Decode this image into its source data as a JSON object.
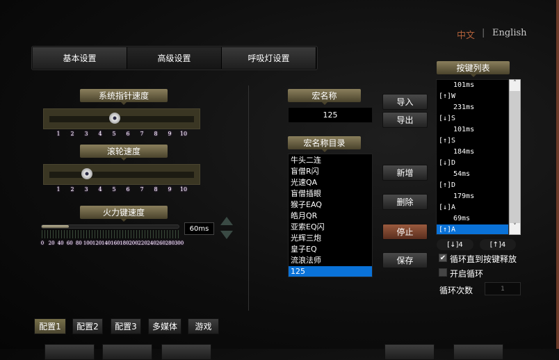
{
  "language": {
    "chinese": "中文",
    "separator": "|",
    "english": "English",
    "active_color": "#b0603a"
  },
  "tabs": [
    {
      "label": "基本设置"
    },
    {
      "label": "高级设置",
      "selected": true
    },
    {
      "label": "呼吸灯设置"
    }
  ],
  "pointer_speed": {
    "label": "系统指针速度",
    "value": 5,
    "ticks": [
      "1",
      "2",
      "3",
      "4",
      "5",
      "6",
      "7",
      "8",
      "9",
      "10"
    ]
  },
  "wheel_speed": {
    "label": "滚轮速度",
    "value": 3,
    "ticks": [
      "1",
      "2",
      "3",
      "4",
      "5",
      "6",
      "7",
      "8",
      "9",
      "10"
    ]
  },
  "fire_speed": {
    "label": "火力键速度",
    "value": 60,
    "max": 300,
    "display": "60ms",
    "ticks": [
      "0",
      "20",
      "40",
      "60",
      "80",
      "100",
      "120",
      "140",
      "160",
      "180",
      "200",
      "220",
      "240",
      "260",
      "280",
      "300"
    ]
  },
  "macro": {
    "name_label": "宏名称",
    "name_value": "125",
    "dir_label": "宏名称目录",
    "items": [
      "牛头二连",
      "盲僧R闪",
      "光速QA",
      "盲僧插眼",
      "猴子EAQ",
      "皓月QR",
      "亚索EQ闪",
      "光辉三炮",
      "皇子EQ",
      "流浪法师",
      "125"
    ],
    "selected_index": 10
  },
  "buttons": {
    "import": "导入",
    "export": "导出",
    "add": "新增",
    "delete": "删除",
    "stop": "停止",
    "save": "保存"
  },
  "key_list": {
    "label": "按键列表",
    "items": [
      "101ms",
      "[↑]W",
      "231ms",
      "[↓]S",
      "101ms",
      "[↑]S",
      "184ms",
      "[↓]D",
      "54ms",
      "[↑]D",
      "179ms",
      "[↓]A",
      "69ms",
      "[↑]A"
    ],
    "selected_index": 13,
    "down_count": "[↓]4",
    "up_count": "[↑]4"
  },
  "loop": {
    "until_release": "循环直到按键释放",
    "until_release_checked": true,
    "enable": "开启循环",
    "enable_checked": false,
    "count_label": "循环次数",
    "count_value": "1"
  },
  "configs": [
    {
      "label": "配置1",
      "selected": true
    },
    {
      "label": "配置2"
    },
    {
      "label": "配置3"
    },
    {
      "label": "多媒体"
    },
    {
      "label": "游戏"
    }
  ]
}
